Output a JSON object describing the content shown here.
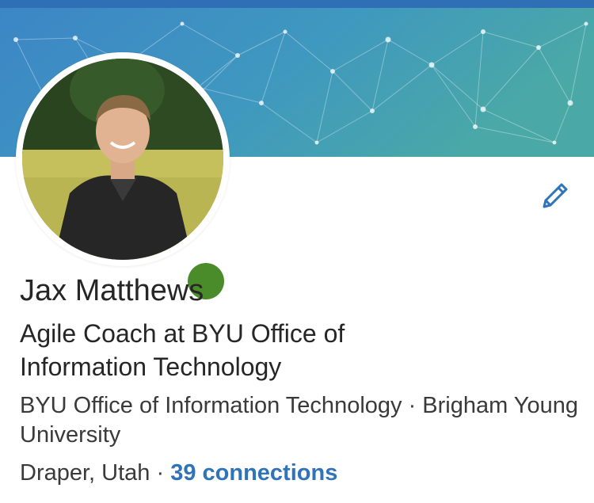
{
  "profile": {
    "name": "Jax Matthews",
    "headline": "Agile Coach at BYU Office of Information Technology",
    "education_company": "BYU Office of Information Technology · Brigham Young University",
    "location": "Draper, Utah",
    "separator": " · ",
    "connections": "39 connections",
    "online_status": "online"
  },
  "colors": {
    "accent": "#2f73b8",
    "presence": "#4a8c2a",
    "cover_start": "#3a8ac7",
    "cover_end": "#4aa8a8"
  },
  "icons": {
    "edit": "pencil-icon"
  }
}
